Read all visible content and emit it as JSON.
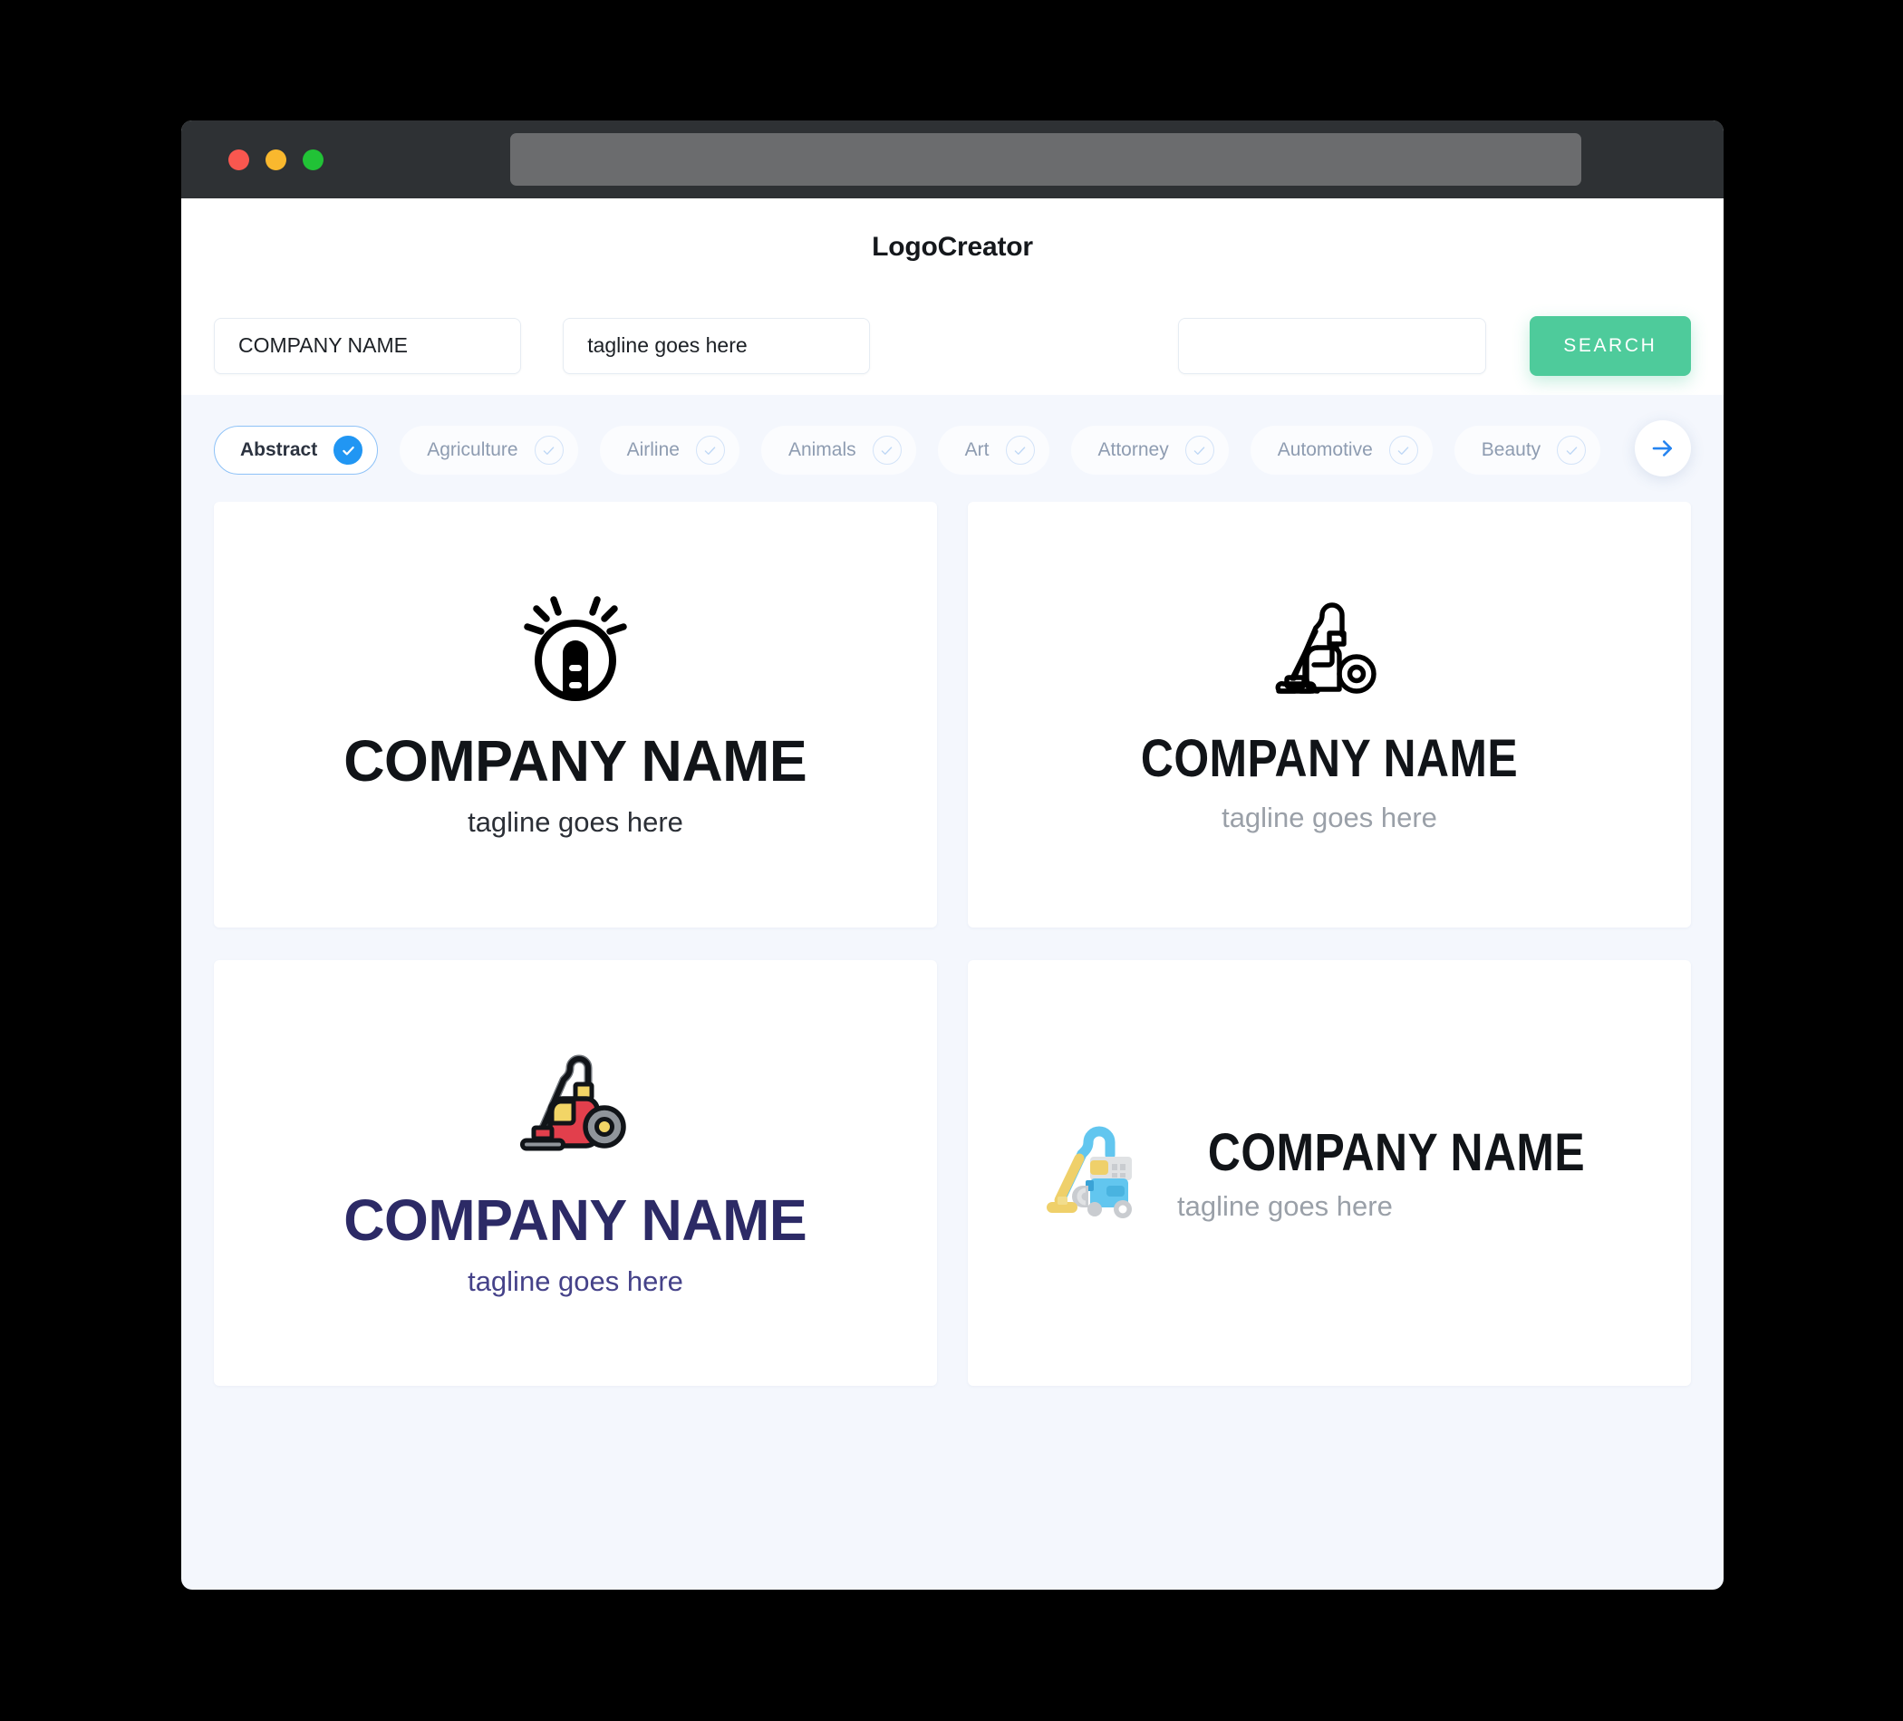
{
  "window": {
    "traffic_lights": [
      "close",
      "minimize",
      "maximize"
    ],
    "url_value": ""
  },
  "header": {
    "title": "LogoCreator"
  },
  "search": {
    "company_value": "COMPANY NAME",
    "tagline_value": "tagline goes here",
    "extra_value": "",
    "search_label": "SEARCH",
    "accent_color": "#4ecb9b"
  },
  "categories": {
    "items": [
      {
        "label": "Abstract",
        "selected": true
      },
      {
        "label": "Agriculture",
        "selected": false
      },
      {
        "label": "Airline",
        "selected": false
      },
      {
        "label": "Animals",
        "selected": false
      },
      {
        "label": "Art",
        "selected": false
      },
      {
        "label": "Attorney",
        "selected": false
      },
      {
        "label": "Automotive",
        "selected": false
      },
      {
        "label": "Beauty",
        "selected": false
      }
    ],
    "next_icon": "arrow-right-icon",
    "selected_color": "#2196f3"
  },
  "results": {
    "cards": [
      {
        "icon": "lightbulb-vacuum-badge-icon",
        "name": "COMPANY NAME",
        "tagline": "tagline goes here",
        "name_color": "#111418",
        "tagline_color": "#2b2f36",
        "layout": "stacked"
      },
      {
        "icon": "vacuum-outline-icon",
        "name": "COMPANY NAME",
        "tagline": "tagline goes here",
        "name_color": "#111418",
        "tagline_color": "#9aa0a8",
        "layout": "stacked"
      },
      {
        "icon": "vacuum-red-icon",
        "name": "COMPANY NAME",
        "tagline": "tagline goes here",
        "name_color": "#2c2a66",
        "tagline_color": "#454289",
        "layout": "stacked"
      },
      {
        "icon": "vacuum-blue-icon",
        "name": "COMPANY NAME",
        "tagline": "tagline goes here",
        "name_color": "#111418",
        "tagline_color": "#9aa0a8",
        "layout": "horizontal"
      }
    ]
  }
}
